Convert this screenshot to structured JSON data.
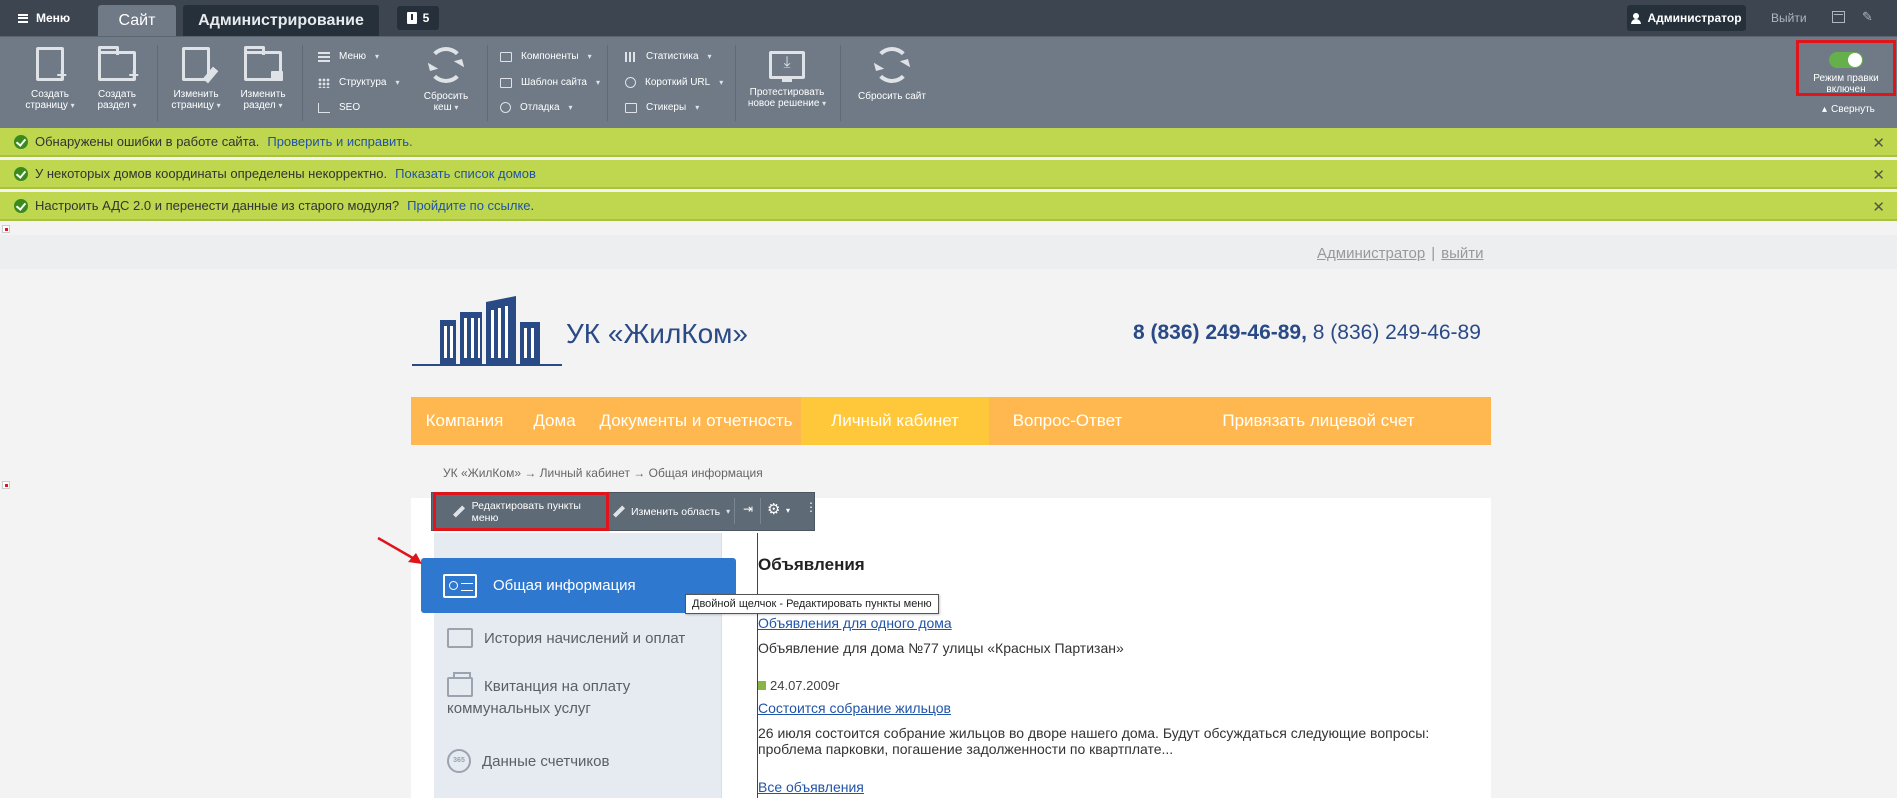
{
  "topbar": {
    "menu_label": "Меню",
    "tab_site": "Сайт",
    "tab_admin": "Администрирование",
    "notifications_count": "5",
    "user_label": "Администратор",
    "logout_label": "Выйти"
  },
  "toolbar": {
    "create_page_1": "Создать",
    "create_page_2": "страницу",
    "create_section_1": "Создать",
    "create_section_2": "раздел",
    "edit_page_1": "Изменить",
    "edit_page_2": "страницу",
    "edit_section_1": "Изменить",
    "edit_section_2": "раздел",
    "menu": "Меню",
    "structure": "Структура",
    "seo": "SEO",
    "reset_cache_1": "Сбросить",
    "reset_cache_2": "кеш",
    "components": "Компоненты",
    "site_template": "Шаблон сайта",
    "debug": "Отладка",
    "statistics": "Статистика",
    "short_url": "Короткий URL",
    "stickers": "Стикеры",
    "test_solution_1": "Протестировать",
    "test_solution_2": "новое решение",
    "reset_site": "Сбросить сайт",
    "edit_mode_1": "Режим правки",
    "edit_mode_2": "включен",
    "collapse": "Свернуть"
  },
  "alerts": [
    {
      "text": "Обнаружены ошибки в работе сайта.",
      "link": "Проверить и исправить."
    },
    {
      "text": "У некоторых домов координаты определены некорректно.",
      "link": "Показать список домов"
    },
    {
      "text": "Настроить АДС 2.0 и перенести данные из старого модуля?",
      "link": "Пройдите по ссылке",
      "suffix": "."
    }
  ],
  "site": {
    "login_user": "Администратор",
    "login_sep": "|",
    "login_exit": "выйти",
    "logo_text": "УК «ЖилКом»",
    "phone_bold": "8 (836) 249-46-89,",
    "phone_regular": " 8 (836) 249-46-89",
    "menu": [
      {
        "label": "Компания"
      },
      {
        "label": "Дома"
      },
      {
        "label": "Документы и отчетность"
      },
      {
        "label": "Личный кабинет"
      },
      {
        "label": "Вопрос-Ответ"
      },
      {
        "label": "Привязать лицевой счет"
      }
    ],
    "breadcrumbs": "УК «ЖилКом»  →  Личный кабинет  →  Общая информация"
  },
  "editbar": {
    "edit_menu_items": "Редактировать пункты меню",
    "change_area": "Изменить область"
  },
  "leftnav": {
    "active": "Общая информация",
    "history": "История начислений и оплат",
    "receipt_1": "Квитанция на оплату",
    "receipt_2": "коммунальных услуг",
    "meters": "Данные счетчиков",
    "meters_icon_text": "365"
  },
  "tooltip": "Двойной щелчок - Редактировать пункты меню",
  "announcements": {
    "title": "Объявления",
    "item1_link": "Объявления для одного дома",
    "item1_text": "Объявление для дома №77 улицы «Красных Партизан»",
    "item2_date": "24.07.2009г",
    "item2_link": "Состоится собрание жильцов",
    "item2_text": "26 июля состоится собрание жильцов во дворе нашего дома. Будут обсуждаться следующие вопросы: проблема парковки, погашение задолженности по квартплате...",
    "all_link": "Все объявления"
  },
  "colors": {
    "admin_bar": "#3d4551",
    "toolbar": "#6f7a86",
    "alert_green": "#bfd64f",
    "highlight_red": "#e0141b",
    "orange_menu": "#ffb84f",
    "active_blue": "#2f78cf",
    "brand_blue": "#2a4a86"
  }
}
